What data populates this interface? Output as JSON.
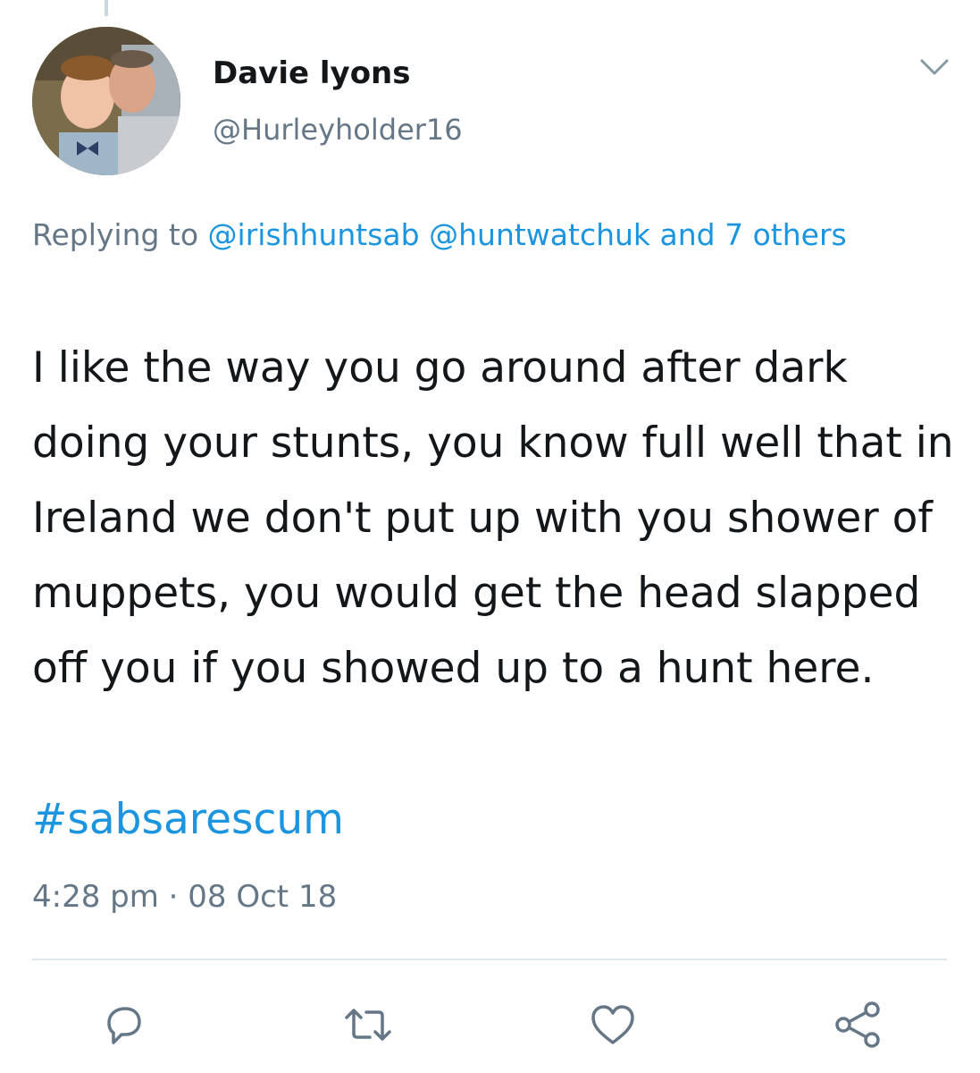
{
  "tweet": {
    "author": {
      "display_name": "Davie lyons",
      "handle": "@Hurleyholder16"
    },
    "reply": {
      "prefix": "Replying to ",
      "mention_1": "@irishhuntsab",
      "mention_2": "@huntwatchuk",
      "others": "and 7 others"
    },
    "text": "I like the way you go around after dark doing your stunts, you know full well that in Ireland we don't put up with you shower of muppets, you would get the head slapped off you if you showed up to a hunt here.",
    "hashtag": "#sabsarescum",
    "timestamp": "4:28 pm · 08 Oct 18"
  },
  "actions": {
    "reply_icon": "reply-icon",
    "retweet_icon": "retweet-icon",
    "like_icon": "heart-icon",
    "share_icon": "share-icon"
  },
  "colors": {
    "link": "#1b95e0",
    "secondary_text": "#657786",
    "primary_text": "#14171a",
    "divider": "#e1e8ed"
  }
}
